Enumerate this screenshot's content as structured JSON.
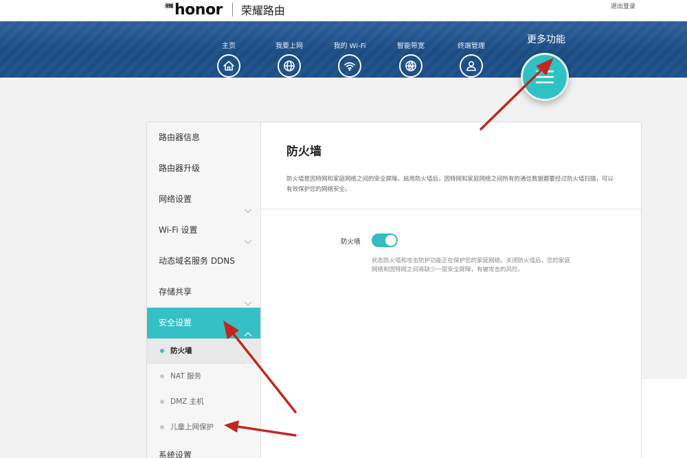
{
  "header": {
    "brand_stamp": "荣耀",
    "brand_word": "honor",
    "product_name": "荣耀路由",
    "logout": "退出登录"
  },
  "nav": {
    "items": [
      {
        "label": "主页",
        "icon": "home-icon"
      },
      {
        "label": "我要上网",
        "icon": "globe-icon"
      },
      {
        "label": "我的 Wi-Fi",
        "icon": "wifi-icon"
      },
      {
        "label": "智能带宽",
        "icon": "bandwidth-globe-icon"
      },
      {
        "label": "终端管理",
        "icon": "user-icon"
      }
    ],
    "more_label": "更多功能",
    "more_icon": "hamburger-menu-icon"
  },
  "sidebar": {
    "items": [
      {
        "label": "路由器信息"
      },
      {
        "label": "路由器升级"
      },
      {
        "label": "网络设置"
      },
      {
        "label": "Wi-Fi 设置"
      },
      {
        "label": "动态域名服务 DDNS"
      },
      {
        "label": "存储共享"
      },
      {
        "label": "安全设置"
      },
      {
        "label": "系统设置"
      }
    ],
    "sub_items": [
      {
        "label": "防火墙"
      },
      {
        "label": "NAT 服务"
      },
      {
        "label": "DMZ 主机"
      },
      {
        "label": "儿童上网保护"
      }
    ]
  },
  "content": {
    "title": "防火墙",
    "description": "防火墙是因特网和家庭网络之间的安全屏障。启用防火墙后，因特网和家庭网络之间所有的通信数据都要经过防火墙扫描，可以有效保护您的网络安全。",
    "firewall_label": "防火墙",
    "firewall_enabled": true,
    "firewall_status_text": "状态防火墙和攻击防护功能正在保护您的家庭网络。关闭防火墙后，您的家庭网络和因特网之间将缺少一层安全屏障，有被攻击的风险。"
  },
  "colors": {
    "accent": "#35c0c5",
    "banner": "#1a4b82",
    "annotation_arrow": "#c0281e"
  }
}
